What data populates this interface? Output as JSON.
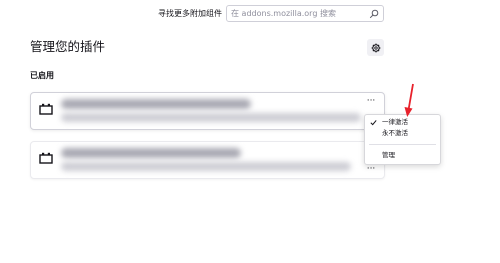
{
  "header": {
    "find_more_label": "寻找更多附加组件",
    "search_placeholder": "在 addons.mozilla.org 搜索",
    "search_value": ""
  },
  "page_title": "管理您的插件",
  "section_title": "已启用",
  "extensions": [
    {
      "more_label": "···"
    },
    {
      "more_label": "···"
    }
  ],
  "context_menu": {
    "items": [
      {
        "label": "一律激活",
        "checked": true
      },
      {
        "label": "永不激活",
        "checked": false
      },
      {
        "label": "管理",
        "checked": false
      }
    ]
  },
  "colors": {
    "annotation_arrow": "#e8212b",
    "text": "#15141a",
    "border": "#cfcfd8"
  },
  "icons": {
    "search": "search-icon",
    "settings": "gear-icon",
    "extension": "plugin-icon",
    "check": "check-icon"
  }
}
